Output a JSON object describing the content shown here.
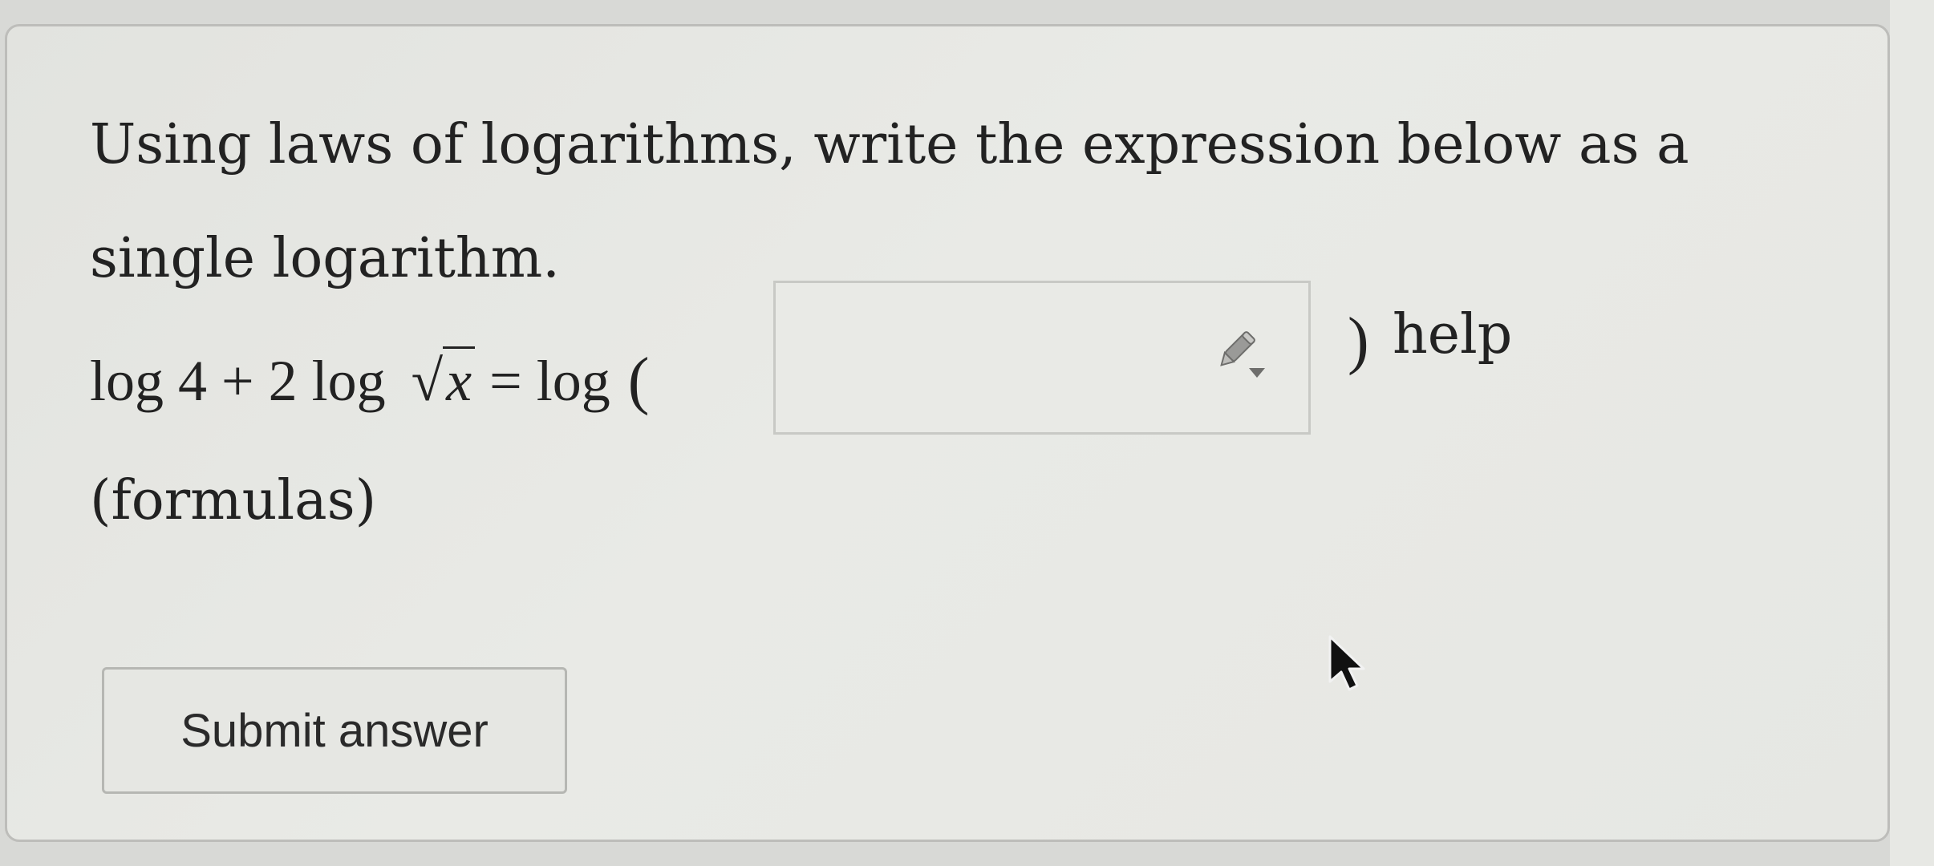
{
  "question": {
    "text": "Using laws of logarithms, write the expression below as a single logarithm."
  },
  "equation": {
    "lhs_prefix": "log 4 + 2 log ",
    "radicand": "x",
    "equals_log": " = log",
    "open_paren": "(",
    "close_paren": ")"
  },
  "answer_input": {
    "value": "",
    "icon": "pencil-dropdown-icon"
  },
  "links": {
    "help": "help",
    "formulas": "(formulas)"
  },
  "submit": {
    "label": "Submit answer"
  },
  "cursor": {
    "icon": "mouse-pointer-icon"
  }
}
